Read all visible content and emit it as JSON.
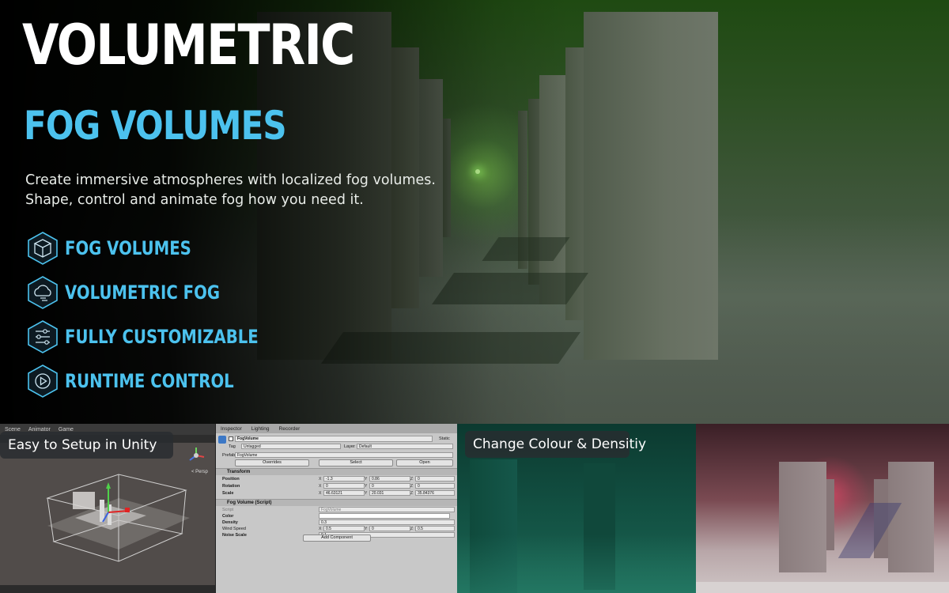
{
  "hero": {
    "title": "VOLUMETRIC",
    "subtitle": "FOG VOLUMES",
    "description_line1": "Create immersive atmospheres with localized fog volumes.",
    "description_line2": "Shape, control and animate fog how you need it.",
    "features": [
      {
        "label": "FOG VOLUMES",
        "icon": "cube-icon"
      },
      {
        "label": "VOLUMETRIC FOG",
        "icon": "cloud-icon"
      },
      {
        "label": "FULLY CUSTOMIZABLE",
        "icon": "sliders-icon"
      },
      {
        "label": "RUNTIME CONTROL",
        "icon": "play-icon"
      }
    ],
    "colors": {
      "accent": "#4cc2ee",
      "fog": "#3d5538"
    }
  },
  "panels": {
    "scene": {
      "badge": "Easy to Setup in Unity",
      "tabs": [
        "Scene",
        "Animator",
        "Game"
      ],
      "persp_label": "< Persp"
    },
    "inspector": {
      "tabs": [
        "Inspector",
        "Lighting",
        "Recorder"
      ],
      "object_name": "FogVolume",
      "static_label": "Static",
      "tag_label": "Tag",
      "tag_value": "Untagged",
      "layer_label": "Layer",
      "layer_value": "Default",
      "prefab_label": "Prefab",
      "prefab_value": "FogVolume",
      "overrides_label": "Overrides",
      "select_label": "Select",
      "open_label": "Open",
      "transform_header": "Transform",
      "position_label": "Position",
      "position": {
        "x": "-1.3",
        "y": "0.86",
        "z": "0"
      },
      "rotation_label": "Rotation",
      "rotation": {
        "x": "0",
        "y": "0",
        "z": "0"
      },
      "scale_label": "Scale",
      "scale": {
        "x": "46.63121",
        "y": "20.031",
        "z": "35.84376"
      },
      "component_header": "Fog Volume (Script)",
      "script_label": "Script",
      "script_value": "FogVolume",
      "color_label": "Color",
      "density_label": "Density",
      "density_value": "0.3",
      "wind_label": "Wind Speed",
      "wind": {
        "x": "0.5",
        "y": "0",
        "z": "0.5"
      },
      "noise_label": "Noise Scale",
      "noise_value": "0.1",
      "add_component_label": "Add Component"
    },
    "green": {
      "badge": "Change Colour & Densitiy"
    },
    "red": {
      "color": "#c2354a"
    }
  }
}
